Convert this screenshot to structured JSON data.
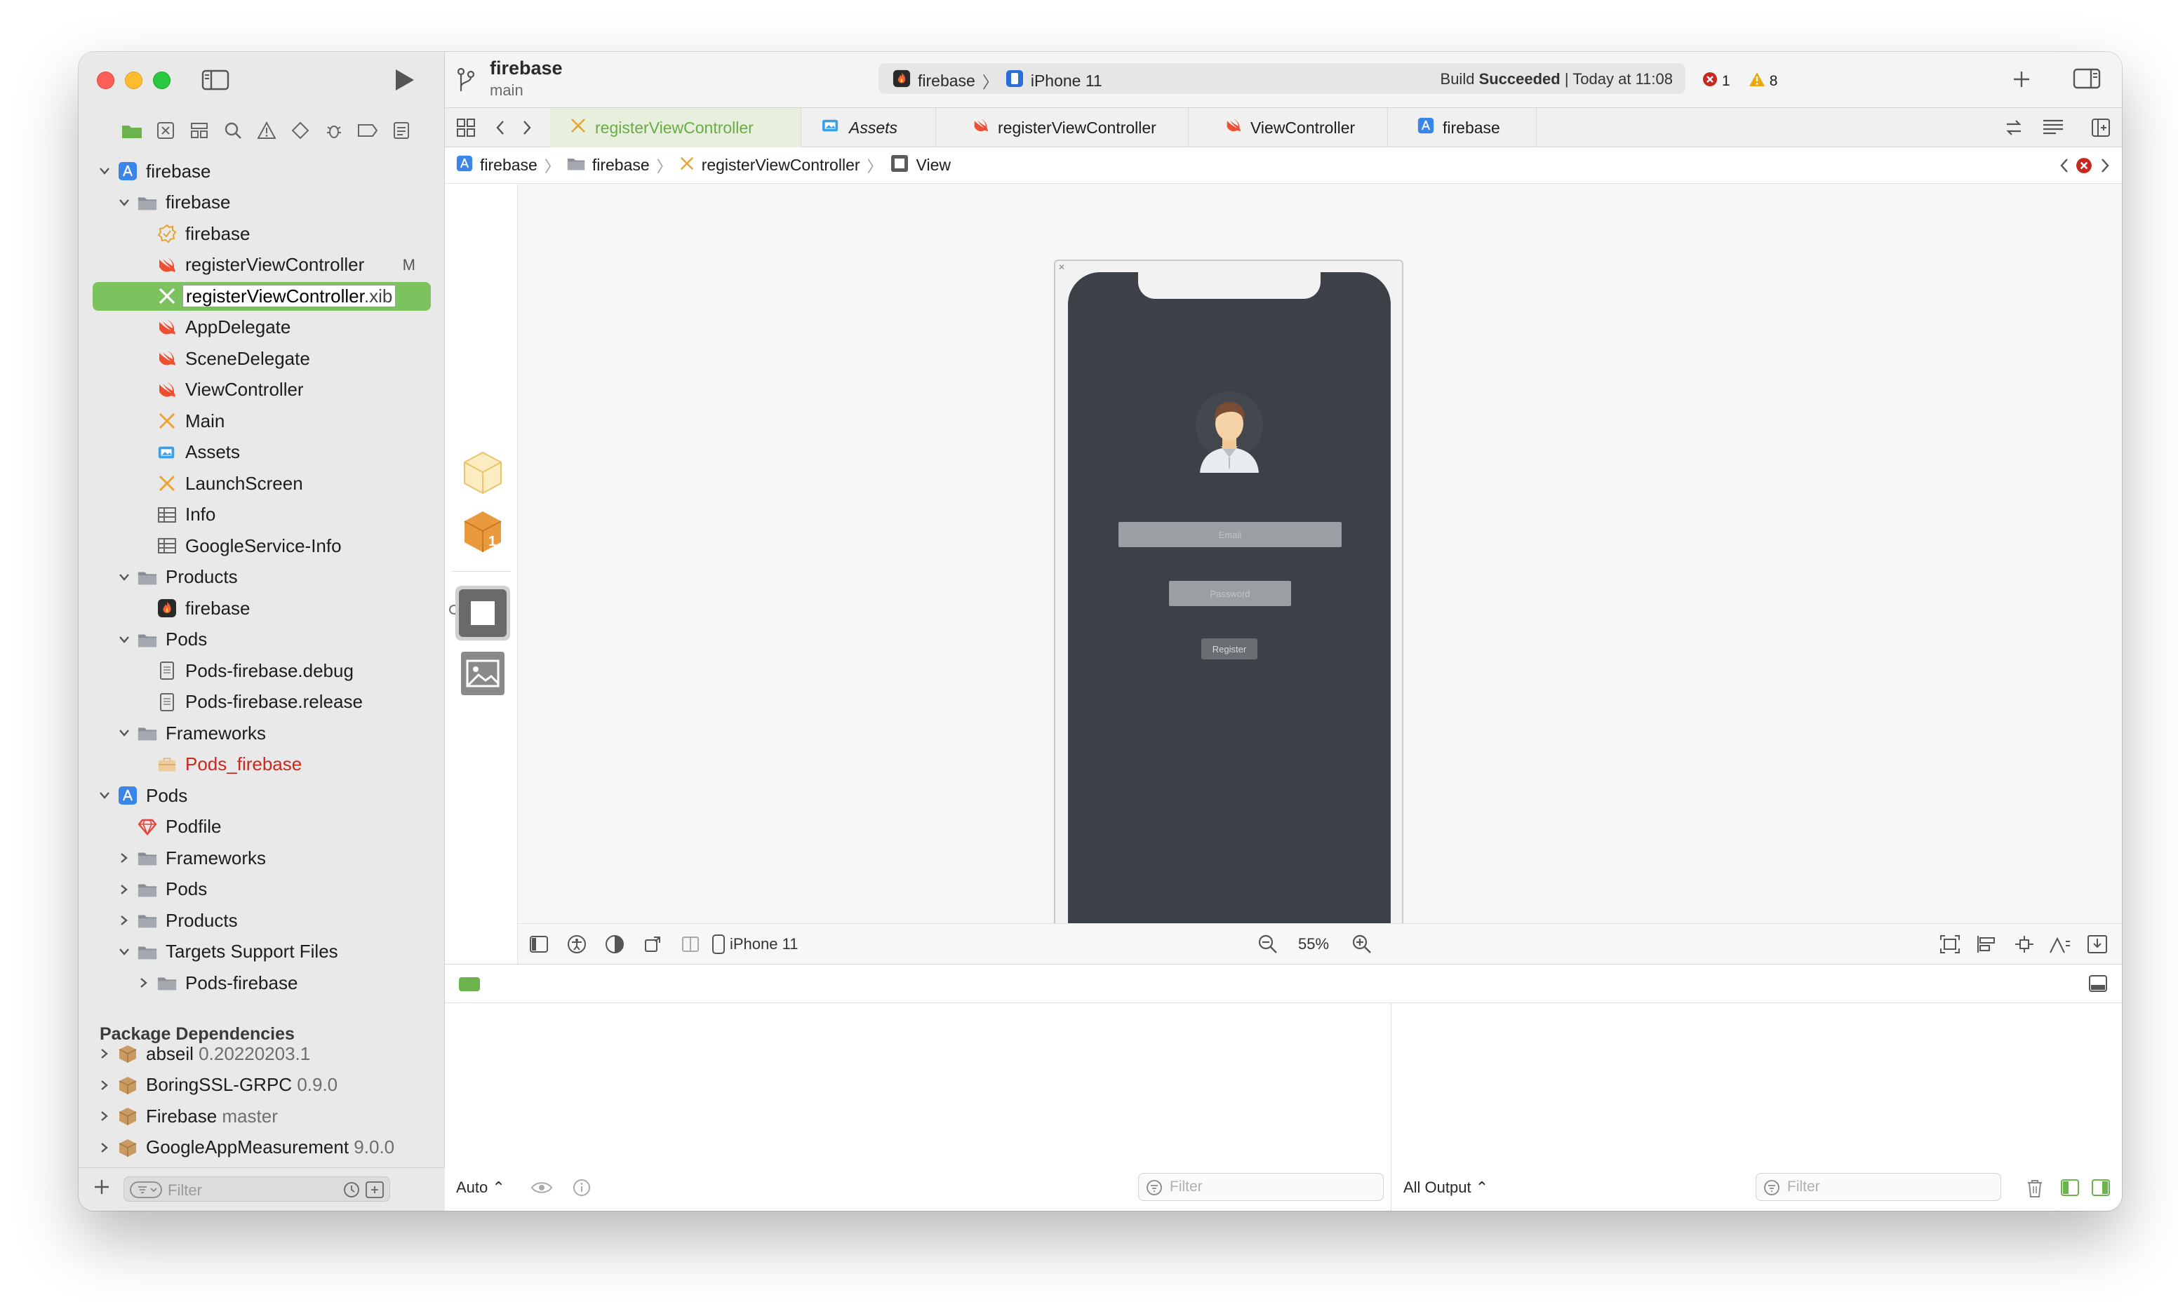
{
  "project": {
    "name": "firebase",
    "branch": "main"
  },
  "activity": {
    "scheme": "firebase",
    "device": "iPhone 11",
    "status_prefix": "Build",
    "status_bold": "Succeeded",
    "status_suffix": "| Today at 11:08",
    "errors": "1",
    "warnings": "8"
  },
  "tabs": [
    {
      "label": "registerViewController"
    },
    {
      "label": "Assets"
    },
    {
      "label": "registerViewController"
    },
    {
      "label": "ViewController"
    },
    {
      "label": "firebase"
    }
  ],
  "jumpbar": [
    "firebase",
    "firebase",
    "registerViewController",
    "View"
  ],
  "tree": [
    {
      "label": "firebase"
    },
    {
      "label": "firebase"
    },
    {
      "label": "firebase"
    },
    {
      "label": "registerViewController",
      "badge": "M"
    },
    {
      "label": "registerViewController",
      "label_ext": ".xib"
    },
    {
      "label": "AppDelegate"
    },
    {
      "label": "SceneDelegate"
    },
    {
      "label": "ViewController"
    },
    {
      "label": "Main"
    },
    {
      "label": "Assets"
    },
    {
      "label": "LaunchScreen"
    },
    {
      "label": "Info"
    },
    {
      "label": "GoogleService-Info"
    },
    {
      "label": "Products"
    },
    {
      "label": "firebase"
    },
    {
      "label": "Pods"
    },
    {
      "label": "Pods-firebase.debug"
    },
    {
      "label": "Pods-firebase.release"
    },
    {
      "label": "Frameworks"
    },
    {
      "label": "Pods_firebase"
    },
    {
      "label": "Pods"
    },
    {
      "label": "Podfile"
    },
    {
      "label": "Frameworks"
    },
    {
      "label": "Pods"
    },
    {
      "label": "Products"
    },
    {
      "label": "Targets Support Files"
    },
    {
      "label": "Pods-firebase"
    }
  ],
  "packages": {
    "heading": "Package Dependencies",
    "items": [
      {
        "name": "abseil",
        "version": "0.20220203.1"
      },
      {
        "name": "BoringSSL-GRPC",
        "version": "0.9.0"
      },
      {
        "name": "Firebase",
        "version": "master"
      },
      {
        "name": "GoogleAppMeasurement",
        "version": "9.0.0"
      }
    ]
  },
  "sidebar_filter": {
    "placeholder": "Filter"
  },
  "phone": {
    "email_placeholder": "Email",
    "password_placeholder": "Password",
    "register_label": "Register"
  },
  "canvas_bar": {
    "device": "iPhone 11",
    "zoom": "55%"
  },
  "console": {
    "left_mode": "Auto ⌃",
    "right_mode": "All Output ⌃",
    "filter_placeholder": "Filter"
  },
  "colors": {
    "selection": "#7cc35f",
    "active_tab": "#6aab46",
    "error": "#c8281e",
    "warning": "#e9a80c",
    "phone_bg": "#3c4047"
  }
}
